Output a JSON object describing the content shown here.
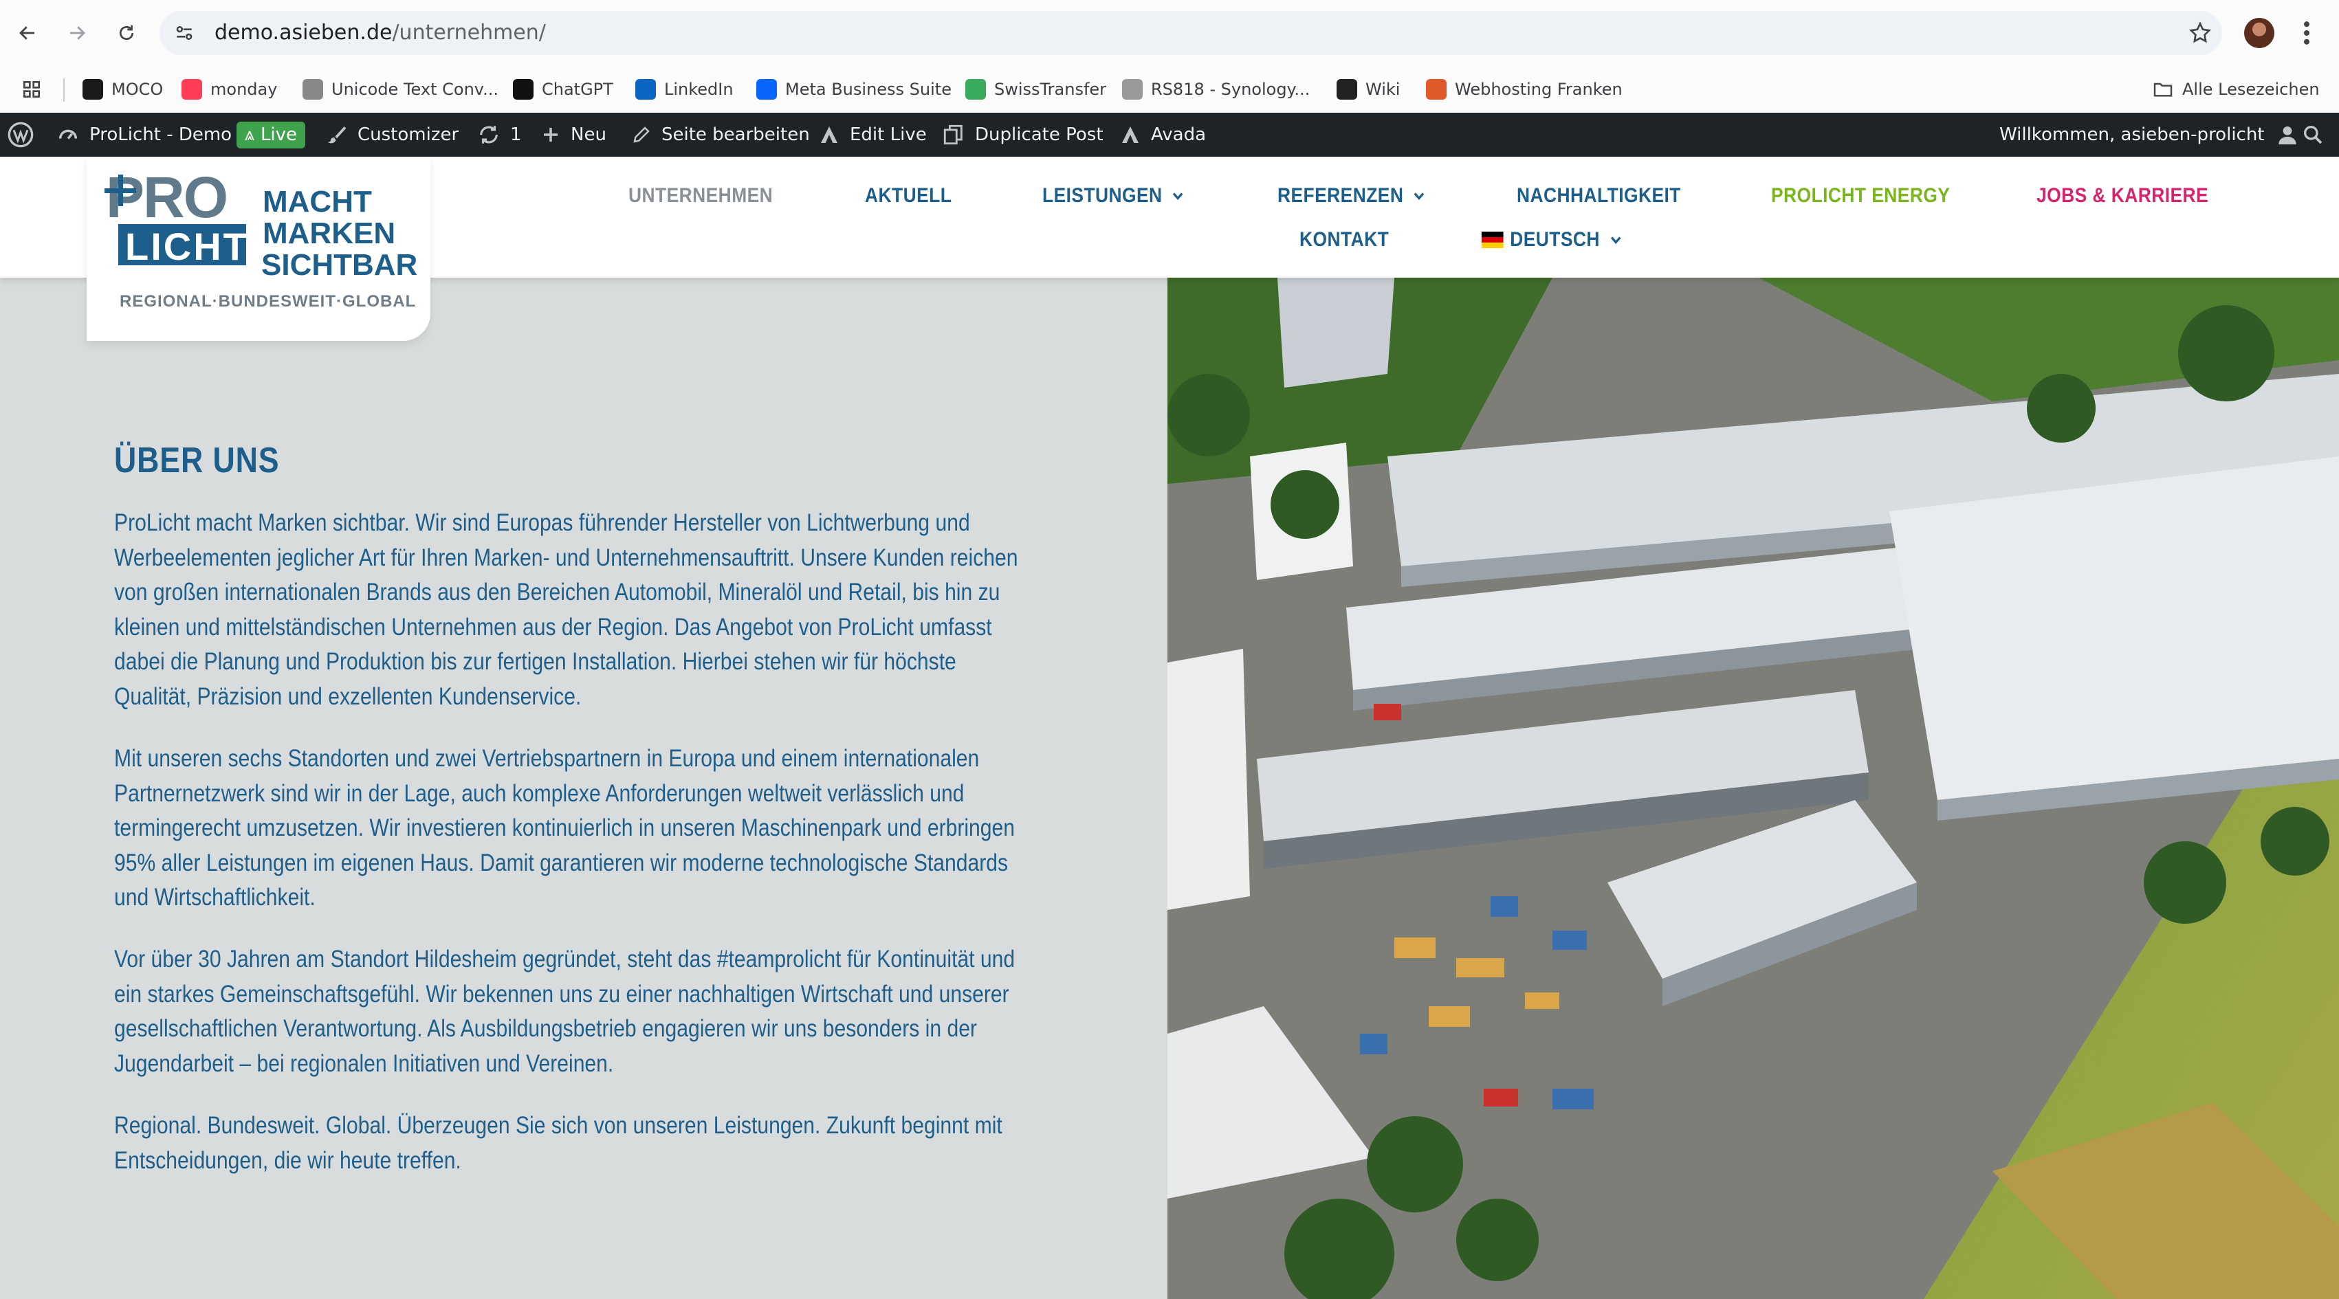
{
  "browser": {
    "url_host": "demo.asieben.de",
    "url_path": "/unternehmen/",
    "bookmarks": [
      {
        "label": "MOCO",
        "icon": "moco-icon",
        "color": "#1a1a1a"
      },
      {
        "label": "monday",
        "icon": "monday-icon",
        "color": "#ff3d57"
      },
      {
        "label": "Unicode Text Conv...",
        "icon": "unicode-icon",
        "color": "#888888"
      },
      {
        "label": "ChatGPT",
        "icon": "chatgpt-icon",
        "color": "#111111"
      },
      {
        "label": "LinkedIn",
        "icon": "linkedin-icon",
        "color": "#0a66c2"
      },
      {
        "label": "Meta Business Suite",
        "icon": "meta-icon",
        "color": "#0866ff"
      },
      {
        "label": "SwissTransfer",
        "icon": "swisstransfer-icon",
        "color": "#3aaa5c"
      },
      {
        "label": "RS818 - Synology...",
        "icon": "synology-icon",
        "color": "#999999"
      },
      {
        "label": "Wiki",
        "icon": "wiki-icon",
        "color": "#222222"
      },
      {
        "label": "Webhosting Franken",
        "icon": "webhosting-icon",
        "color": "#e05a2a"
      }
    ],
    "all_bookmarks": "Alle Lesezeichen"
  },
  "adminbar": {
    "site_name": "ProLicht - Demo",
    "live": "Live",
    "customizer": "Customizer",
    "updates": "1",
    "new": "Neu",
    "edit_page": "Seite bearbeiten",
    "edit_live": "Edit Live",
    "duplicate": "Duplicate Post",
    "avada": "Avada",
    "welcome": "Willkommen, asieben-prolicht"
  },
  "logo": {
    "pro": "PRO",
    "licht": "LICHT",
    "line1": "MACHT",
    "line2": "MARKEN",
    "line3": "SICHTBAR",
    "tagline": "REGIONAL·BUNDESWEIT·GLOBAL"
  },
  "menu": {
    "unternehmen": "UNTERNEHMEN",
    "aktuell": "AKTUELL",
    "leistungen": "LEISTUNGEN",
    "referenzen": "REFERENZEN",
    "nachhaltigkeit": "NACHHALTIGKEIT",
    "energy": "PROLICHT ENERGY",
    "jobs": "JOBS & KARRIERE",
    "kontakt": "KONTAKT",
    "language": "DEUTSCH"
  },
  "colors": {
    "brand_blue": "#1e5e8a",
    "menu_gray": "#8a9096",
    "energy_green": "#7ab51d",
    "jobs_pink": "#d6246e"
  },
  "content": {
    "heading": "ÜBER UNS",
    "p1": "ProLicht macht Marken sichtbar. Wir sind Europas führender Hersteller von Lichtwerbung und Werbeelementen jeglicher Art für Ihren Marken- und Unternehmensauftritt. Unsere Kunden reichen von großen internationalen Brands aus den Bereichen Automobil, Mineralöl und Retail, bis hin zu kleinen und mittelständischen Unternehmen aus der Region. Das Angebot von ProLicht umfasst dabei die Planung und Produktion bis zur fertigen Installation. Hierbei stehen wir für höchste Qualität, Präzision und exzellenten Kundenservice.",
    "p2": "Mit unseren sechs Standorten und zwei Vertriebspartnern in Europa und einem internationalen Partnernetzwerk sind wir in der Lage, auch komplexe Anforderungen weltweit verlässlich und termingerecht umzusetzen. Wir investieren kontinuierlich in unseren Maschinenpark und erbringen 95% aller Leistungen im eigenen Haus. Damit garantieren wir moderne technologische Standards und Wirtschaftlichkeit.",
    "p3": "Vor über 30 Jahren am Standort Hildesheim gegründet, steht das #teamprolicht für Kontinuität und ein starkes Gemeinschaftsgefühl. Wir bekennen uns zu einer nachhaltigen Wirtschaft und unserer gesellschaftlichen Verantwortung. Als Ausbildungsbetrieb engagieren wir uns besonders in der Jugendarbeit – bei regionalen Initiativen und Vereinen.",
    "p4": "Regional. Bundesweit. Global. Überzeugen Sie sich von unseren Leistungen. Zukunft beginnt mit Entscheidungen, die wir heute treffen."
  }
}
